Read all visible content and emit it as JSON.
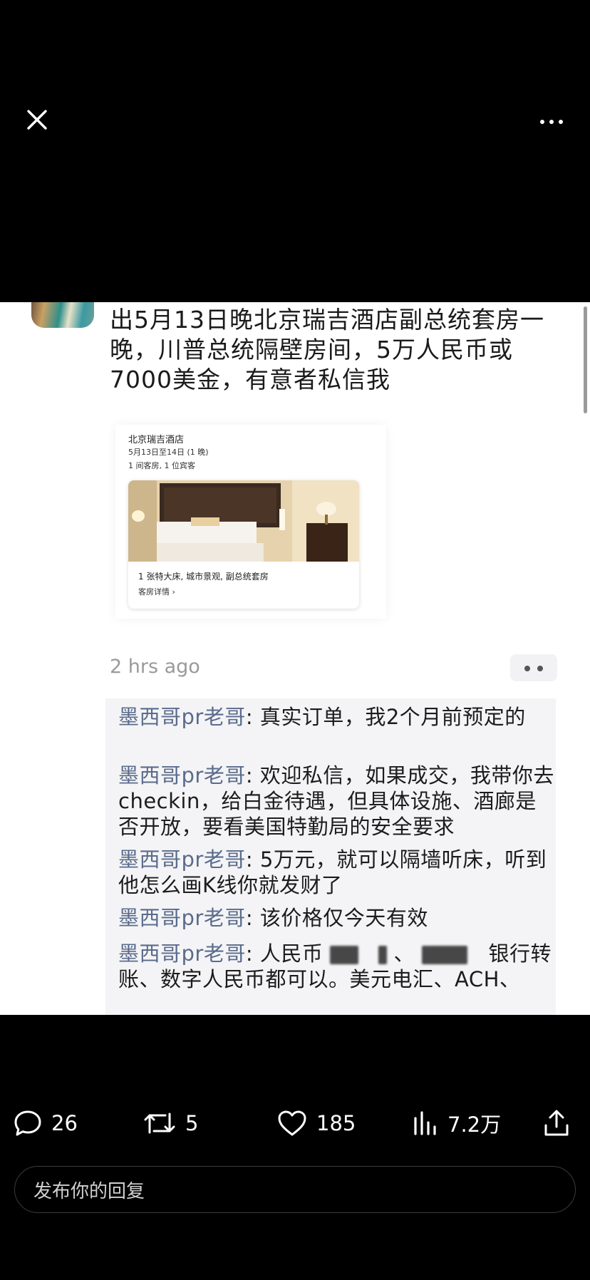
{
  "post": {
    "text": "出5月13日晚北京瑞吉酒店副总统套房一晚，川普总统隔壁房间，5万人民币或7000美金，有意者私信我",
    "time": "2 hrs ago"
  },
  "card": {
    "hotel": "北京瑞吉酒店",
    "dates": "5月13日至14日 (1 晚)",
    "guests": "1 间客房, 1 位宾客",
    "room_desc": "1 张特大床, 城市景观, 副总统套房",
    "room_link": "客房详情 ›"
  },
  "comments": [
    {
      "name": "墨西哥pr老哥",
      "text": ": 真实订单，我2个月前预定的"
    },
    {
      "name": "墨西哥pr老哥",
      "text": ": 欢迎私信，如果成交，我带你去checkin，给白金待遇，但具体设施、酒廊是否开放，要看美国特勤局的安全要求"
    },
    {
      "name": "墨西哥pr老哥",
      "text": ": 5万元，就可以隔墙听床，听到他怎么画K线你就发财了"
    },
    {
      "name": "墨西哥pr老哥",
      "text": ": 该价格仅今天有效"
    },
    {
      "name": "墨西哥pr老哥",
      "text_a": ": 人民币",
      "text_b": "银行转账、数字人民币都可以。美元电汇、ACH、"
    }
  ],
  "actions": {
    "replies": "26",
    "reposts": "5",
    "likes": "185",
    "views": "7.2万"
  },
  "reply_placeholder": "发布你的回复",
  "icons": [
    "close-icon",
    "more-icon",
    "comment-icon",
    "repost-icon",
    "heart-icon",
    "stats-icon",
    "share-icon"
  ]
}
